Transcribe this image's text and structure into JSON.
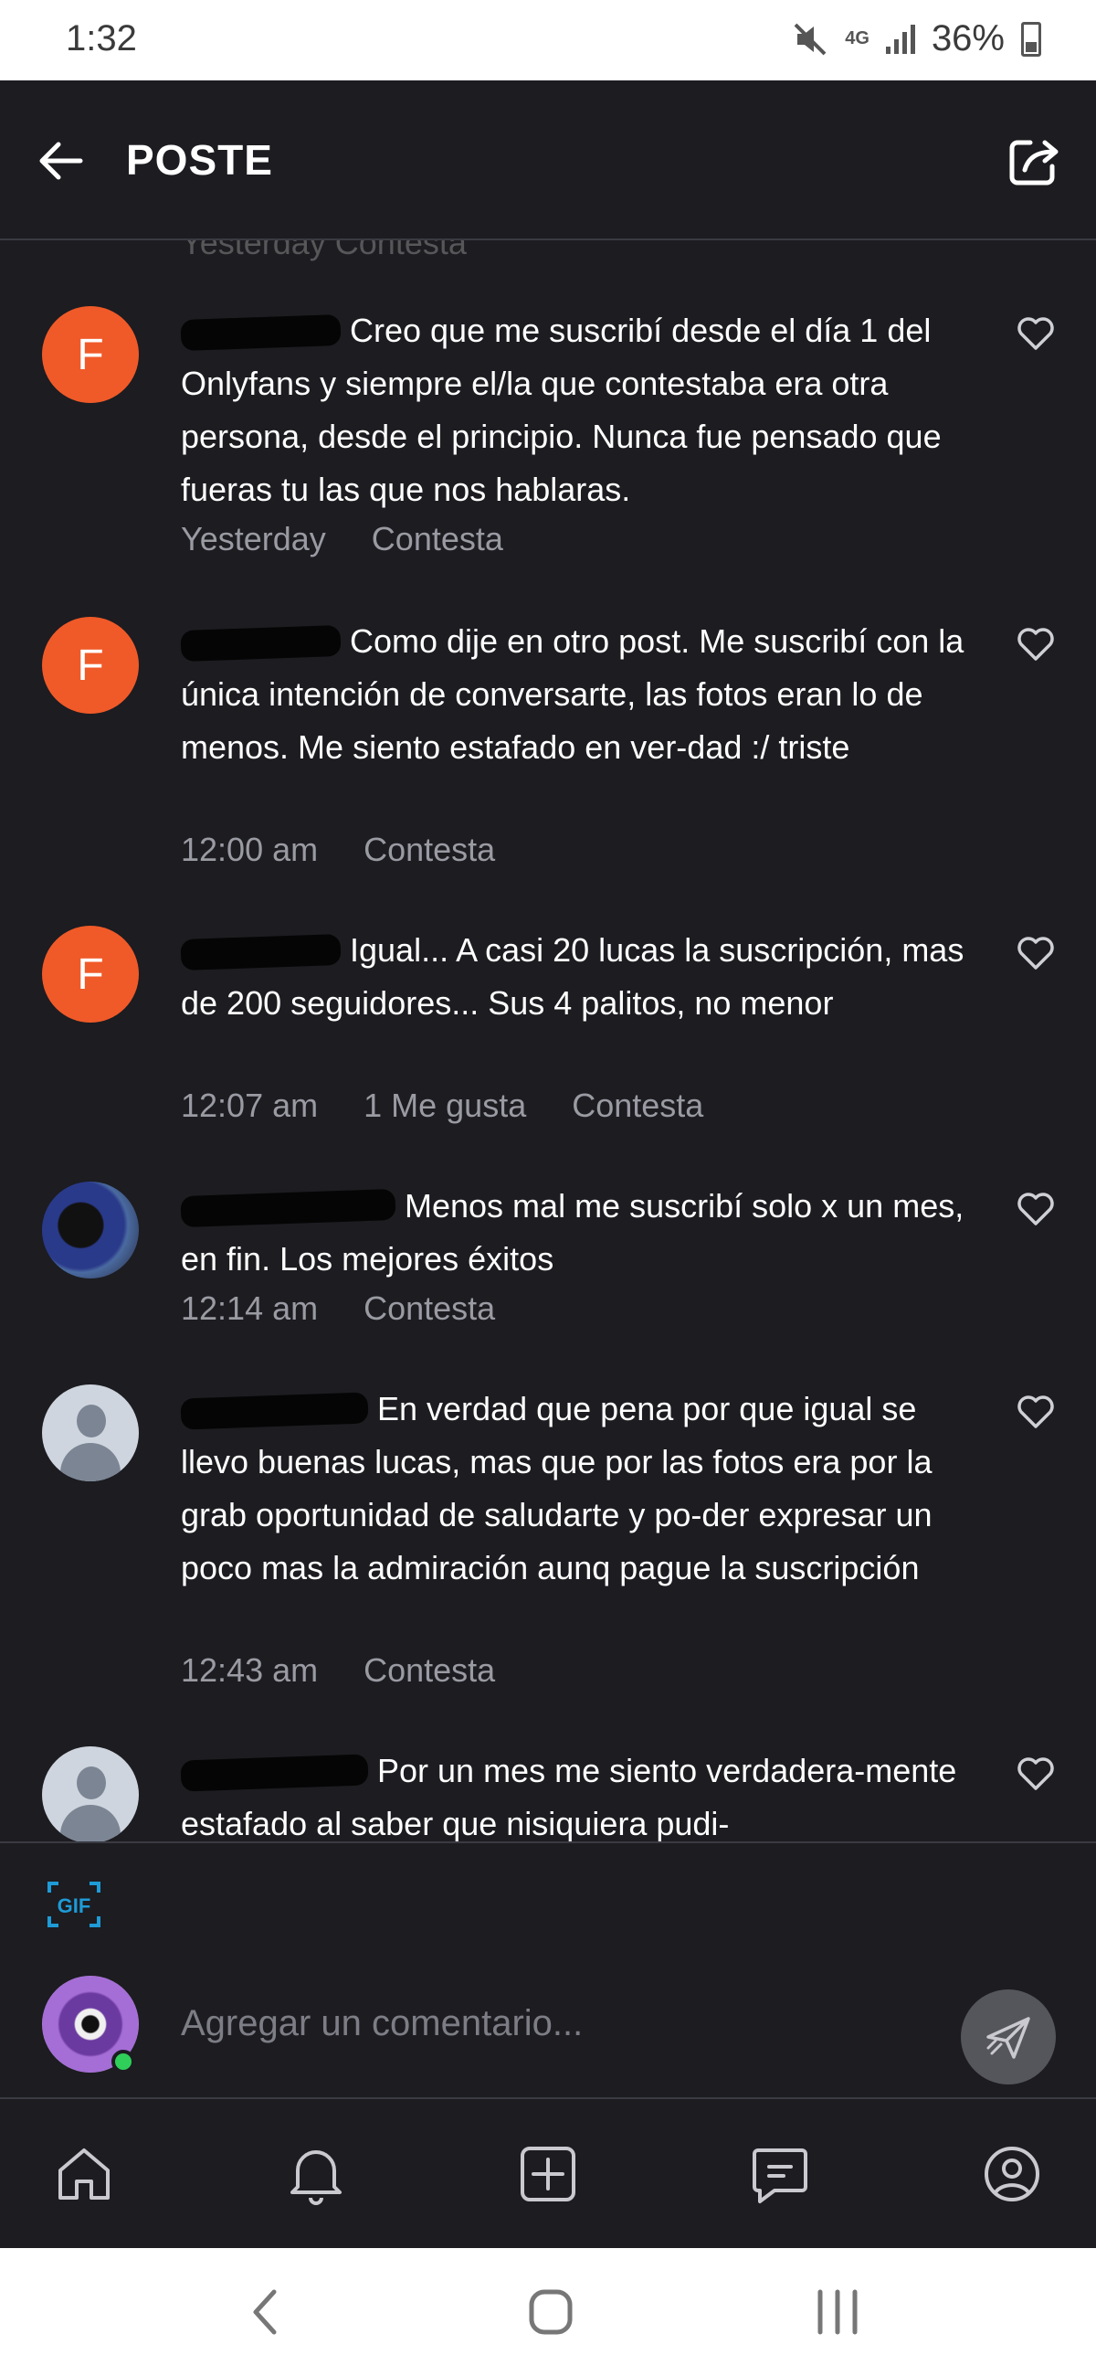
{
  "status_bar": {
    "time": "1:32",
    "network": "4G",
    "battery": "36%"
  },
  "header": {
    "title": "POSTE"
  },
  "ghost_meta": "Yesterday   Contesta",
  "comments": [
    {
      "avatar_letter": "F",
      "text": "Creo que me suscribí desde el día 1 del Onlyfans y siempre el/la que contestaba era otra persona, desde el principio. Nunca fue pensado que fueras tu las que nos hablaras.",
      "time": "Yesterday",
      "reply": "Contesta"
    },
    {
      "avatar_letter": "F",
      "text": "Como dije en otro post. Me suscribí con la única intención de conversarte, las fotos eran lo de menos. Me siento estafado en ver-dad :/ triste",
      "time": "12:00 am",
      "reply": "Contesta"
    },
    {
      "avatar_letter": "F",
      "text": "Igual... A casi 20 lucas la suscripción, mas de 200 seguidores... Sus 4 palitos, no menor",
      "time": "12:07 am",
      "likes": "1 Me gusta",
      "reply": "Contesta"
    },
    {
      "text": "Menos mal me suscribí solo x un mes, en fin. Los mejores éxitos",
      "time": "12:14 am",
      "reply": "Contesta"
    },
    {
      "text": "En verdad que pena por que igual se llevo buenas lucas, mas que por las fotos era por la grab oportunidad de saludarte y po-der expresar un poco mas la admiración aunq pague la suscripción",
      "time": "12:43 am",
      "reply": "Contesta"
    },
    {
      "text": "Por un mes me siento verdadera-mente estafado al saber que nisiquiera pudi-"
    }
  ],
  "composer": {
    "placeholder": "Agregar un comentario...",
    "gif_label": "GIF"
  },
  "icons": [
    "back-arrow-icon",
    "share-icon",
    "heart-icon",
    "gif-icon",
    "send-icon",
    "home-icon",
    "bell-icon",
    "add-icon",
    "message-icon",
    "profile-icon"
  ],
  "colors": {
    "background": "#1c1c21",
    "avatar_orange": "#f05a28",
    "gif_blue": "#1e9bd7",
    "meta_gray": "#9a9aa3"
  }
}
